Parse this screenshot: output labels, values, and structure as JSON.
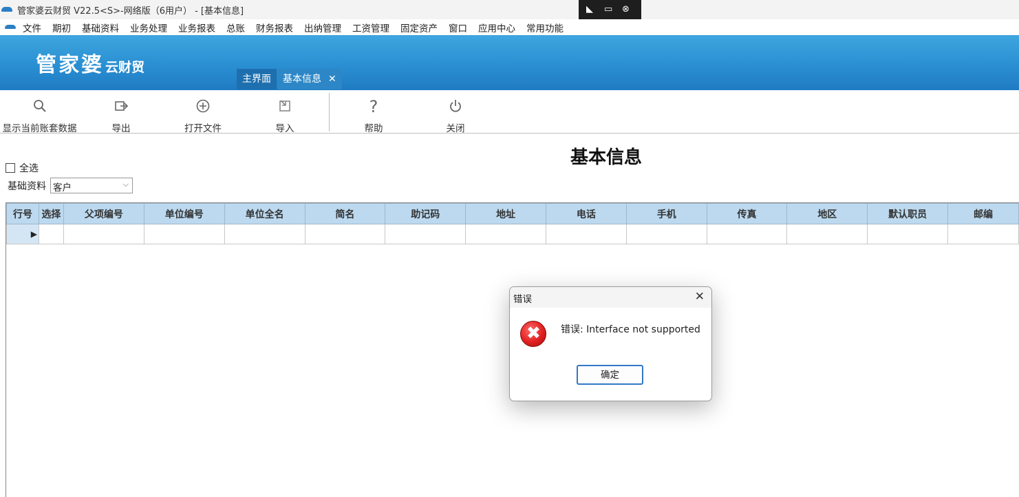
{
  "titlebar": {
    "title": "管家婆云财贸 V22.5<S>-网络版（6用户） - [基本信息]"
  },
  "remote_bar": {
    "icons": [
      "pin-icon",
      "minimize-window-icon",
      "close-session-icon"
    ]
  },
  "menu": {
    "items": [
      "文件",
      "期初",
      "基础资料",
      "业务处理",
      "业务报表",
      "总账",
      "财务报表",
      "出纳管理",
      "工资管理",
      "固定资产",
      "窗口",
      "应用中心",
      "常用功能"
    ]
  },
  "brand": {
    "logo_text": "管家婆",
    "logo_sub": "云财贸"
  },
  "tabs": [
    {
      "label": "主界面"
    },
    {
      "label": "基本信息",
      "close": "✕"
    }
  ],
  "toolbar": {
    "buttons": [
      {
        "label": "显示当前账套数据",
        "icon": "search-icon"
      },
      {
        "label": "导出",
        "icon": "export-icon"
      },
      {
        "label": "打开文件",
        "icon": "plus-circle-icon"
      },
      {
        "label": "导入",
        "icon": "import-icon"
      },
      {
        "label": "帮助",
        "icon": "help-icon"
      },
      {
        "label": "关闭",
        "icon": "power-icon"
      }
    ]
  },
  "page": {
    "title": "基本信息"
  },
  "filters": {
    "select_all_label": "全选",
    "category_label": "基础资料",
    "category_value": "客户"
  },
  "grid": {
    "columns": [
      "行号",
      "选择",
      "父项编号",
      "单位编号",
      "单位全名",
      "简名",
      "助记码",
      "地址",
      "电话",
      "手机",
      "传真",
      "地区",
      "默认职员",
      "邮编"
    ]
  },
  "dialog": {
    "title": "错误",
    "message": "错误: Interface not supported",
    "ok_label": "确定"
  },
  "colors": {
    "banner": "#2a8fd2",
    "grid_header": "#bcd9ef",
    "error_red": "#e02020",
    "focus_blue": "#3277c8"
  }
}
